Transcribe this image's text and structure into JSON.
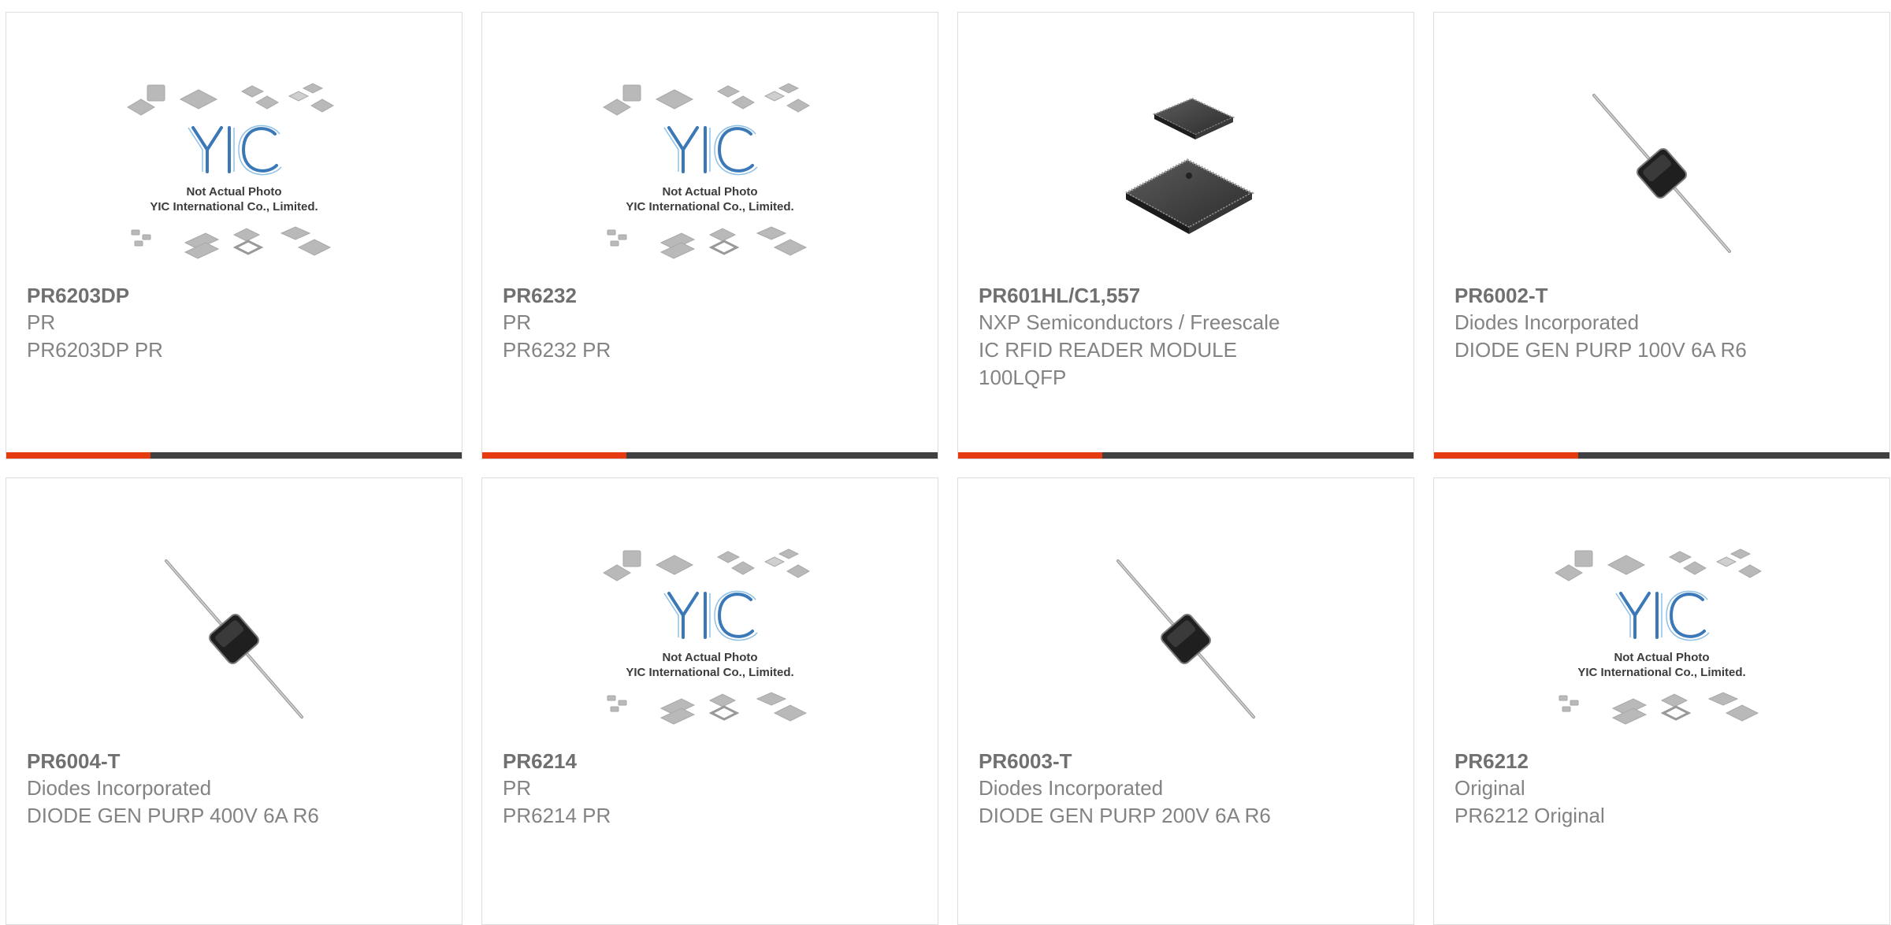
{
  "colors": {
    "accent": "#e63a0f",
    "bar": "#404040",
    "part_text": "#707070",
    "body_text": "#838383",
    "border": "#dedede"
  },
  "placeholder_caption": {
    "line1": "Not Actual Photo",
    "line2": "YIC International Co., Limited."
  },
  "products": [
    {
      "part_number": "PR6203DP",
      "manufacturer": "PR",
      "description": "PR6203DP PR",
      "image": "placeholder"
    },
    {
      "part_number": "PR6232",
      "manufacturer": "PR",
      "description": "PR6232 PR",
      "image": "placeholder"
    },
    {
      "part_number": "PR601HL/C1,557",
      "manufacturer": "NXP Semiconductors / Freescale",
      "description": "IC RFID READER MODULE 100LQFP",
      "image": "lqfp-chip"
    },
    {
      "part_number": "PR6002-T",
      "manufacturer": "Diodes Incorporated",
      "description": "DIODE GEN PURP 100V 6A R6",
      "image": "axial-diode"
    },
    {
      "part_number": "PR6004-T",
      "manufacturer": "Diodes Incorporated",
      "description": "DIODE GEN PURP 400V 6A R6",
      "image": "axial-diode"
    },
    {
      "part_number": "PR6214",
      "manufacturer": "PR",
      "description": "PR6214 PR",
      "image": "placeholder"
    },
    {
      "part_number": "PR6003-T",
      "manufacturer": "Diodes Incorporated",
      "description": "DIODE GEN PURP 200V 6A R6",
      "image": "axial-diode"
    },
    {
      "part_number": "PR6212",
      "manufacturer": "Original",
      "description": "PR6212 Original",
      "image": "placeholder"
    }
  ]
}
